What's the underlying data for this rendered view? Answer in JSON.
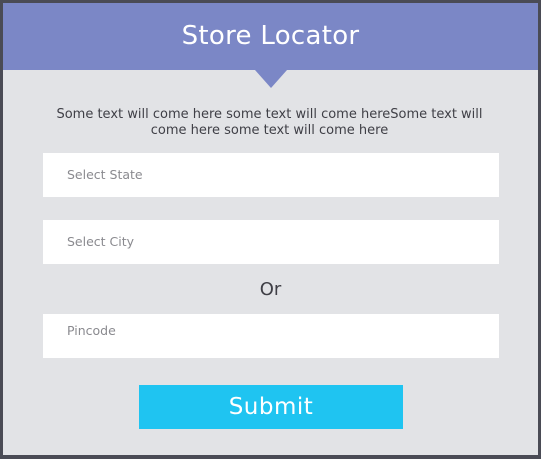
{
  "header": {
    "title": "Store Locator"
  },
  "description": "Some text will come here some text will come hereSome text will come here some text will come here",
  "form": {
    "state_placeholder": "Select State",
    "city_placeholder": "Select City",
    "or_label": "Or",
    "pincode_placeholder": "Pincode",
    "submit_label": "Submit"
  },
  "colors": {
    "header": "#7b87c6",
    "panel": "#e2e3e6",
    "submit": "#1fc4f1",
    "frame": "#4a4b55"
  }
}
